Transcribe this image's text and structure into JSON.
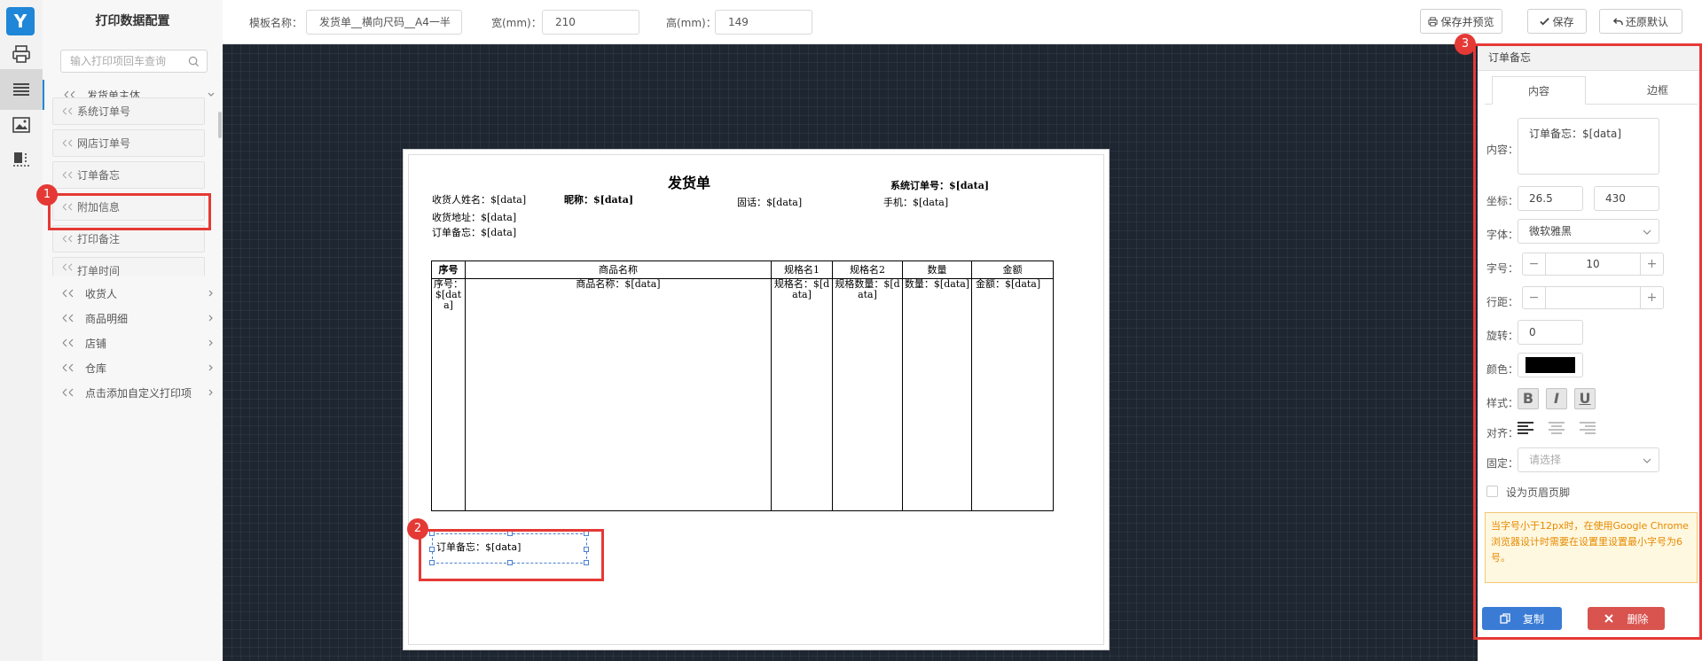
{
  "left_panel": {
    "title": "打印数据配置",
    "search_placeholder": "输入打印项回车查询",
    "groups": [
      {
        "label": "发货单主体"
      },
      {
        "label": "收货人"
      },
      {
        "label": "商品明细"
      },
      {
        "label": "店铺"
      },
      {
        "label": "仓库"
      },
      {
        "label": "点击添加自定义打印项"
      }
    ],
    "items": [
      {
        "label": "系统订单号"
      },
      {
        "label": "网店订单号"
      },
      {
        "label": "订单备忘"
      },
      {
        "label": "附加信息"
      },
      {
        "label": "打印备注"
      },
      {
        "label": "打单时间"
      }
    ]
  },
  "topbar": {
    "template_name_label": "模板名称：",
    "template_name_value": "发货单__横向尺码__A4一半",
    "width_label": "宽(mm)：",
    "width_value": "210",
    "height_label": "高(mm)：",
    "height_value": "149",
    "save_preview_label": "保存并预览",
    "save_label": "保存",
    "restore_label": "还原默认"
  },
  "paper": {
    "title": "发货单",
    "order_no": "系统订单号：$[data]",
    "consignee": "收货人姓名：$[data]",
    "nickname": "昵称：$[data]",
    "phone": "固话：$[data]",
    "mobile": "手机：$[data]",
    "address": "收货地址：$[data]",
    "memo": "订单备忘：$[data]",
    "table": {
      "headers": [
        "序号",
        "商品名称",
        "规格名1",
        "规格名2",
        "数量",
        "金额"
      ],
      "cells": [
        "序号：$[data]",
        "商品名称：$[data]",
        "规格名：$[data]",
        "规格数量：$[data]",
        "数量：$[data]",
        "金额：$[data]"
      ]
    },
    "selected_element_text": "订单备忘：$[data]"
  },
  "right_panel": {
    "title": "订单备忘",
    "tabs": [
      "内容",
      "边框"
    ],
    "content_label": "内容：",
    "content_value": "订单备忘：$[data]",
    "coord_label": "坐标：",
    "coord_x": "26.5",
    "coord_y": "430",
    "font_label": "字体：",
    "font_value": "微软雅黑",
    "size_label": "字号：",
    "size_value": "10",
    "line_label": "行距：",
    "line_value": "",
    "rotate_label": "旋转：",
    "rotate_value": "0",
    "color_label": "颜色：",
    "color_value": "#000000",
    "style_label": "样式：",
    "style_bold": "B",
    "style_italic": "I",
    "style_underline": "U",
    "align_label": "对齐：",
    "fixed_label": "固定：",
    "fixed_placeholder": "请选择",
    "header_footer_label": "设为页眉页脚",
    "notice": "当字号小于12px时，在使用Google Chrome浏览器设计时需要在设置里设置最小字号为6号。",
    "copy_label": "复制",
    "delete_label": "删除"
  },
  "badges": [
    "1",
    "2",
    "3"
  ],
  "colors": {
    "accent": "#1f86d8",
    "highlight": "#e53935",
    "copy_button": "#3a7bd5",
    "delete_button": "#d9534f"
  }
}
